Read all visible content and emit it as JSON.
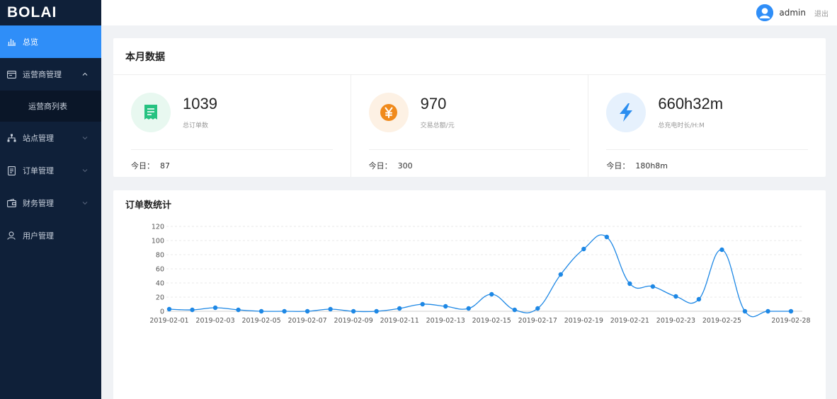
{
  "brand": "BOLAI",
  "sidebar": {
    "items": [
      {
        "label": "总览",
        "icon": "bar-chart-icon",
        "active": true
      },
      {
        "label": "运营商管理",
        "icon": "id-card-icon",
        "expanded": true,
        "children": [
          {
            "label": "运营商列表"
          }
        ]
      },
      {
        "label": "站点管理",
        "icon": "sitemap-icon"
      },
      {
        "label": "订单管理",
        "icon": "document-icon"
      },
      {
        "label": "财务管理",
        "icon": "wallet-icon"
      },
      {
        "label": "用户管理",
        "icon": "user-icon"
      }
    ]
  },
  "header": {
    "username": "admin",
    "logout": "退出"
  },
  "monthly": {
    "title": "本月数据",
    "stats": [
      {
        "value": "1039",
        "label": "总订单数",
        "today_label": "今日：",
        "today_value": "87",
        "icon": "receipt-icon",
        "color": "#26c281",
        "bg": "#e8f8f0"
      },
      {
        "value": "970",
        "label": "交易总额/元",
        "today_label": "今日：",
        "today_value": "300",
        "icon": "yen-icon",
        "color": "#f08a1c",
        "bg": "#fdf1e4"
      },
      {
        "value": "660h32m",
        "label": "总充电时长/H:M",
        "today_label": "今日：",
        "today_value": "180h8m",
        "icon": "lightning-icon",
        "color": "#2b8ef0",
        "bg": "#e6f1fd"
      }
    ]
  },
  "chart_title": "订单数统计",
  "chart_data": {
    "type": "line",
    "smooth": true,
    "color": "#1e88e5",
    "ylim": [
      0,
      120
    ],
    "yticks": [
      0,
      20,
      40,
      60,
      80,
      100,
      120
    ],
    "grid": "horizontal-dashed",
    "x": [
      "2019-02-01",
      "2019-02-02",
      "2019-02-03",
      "2019-02-04",
      "2019-02-05",
      "2019-02-06",
      "2019-02-07",
      "2019-02-08",
      "2019-02-09",
      "2019-02-10",
      "2019-02-11",
      "2019-02-12",
      "2019-02-13",
      "2019-02-14",
      "2019-02-15",
      "2019-02-16",
      "2019-02-17",
      "2019-02-18",
      "2019-02-19",
      "2019-02-20",
      "2019-02-21",
      "2019-02-22",
      "2019-02-23",
      "2019-02-24",
      "2019-02-25",
      "2019-02-26",
      "2019-02-27",
      "2019-02-28"
    ],
    "tick_labels": [
      {
        "i": 0,
        "text": "2019-02-01"
      },
      {
        "i": 2,
        "text": "2019-02-03"
      },
      {
        "i": 4,
        "text": "2019-02-05"
      },
      {
        "i": 6,
        "text": "2019-02-07"
      },
      {
        "i": 8,
        "text": "2019-02-09"
      },
      {
        "i": 10,
        "text": "2019-02-11"
      },
      {
        "i": 12,
        "text": "2019-02-13"
      },
      {
        "i": 14,
        "text": "2019-02-15"
      },
      {
        "i": 16,
        "text": "2019-02-17"
      },
      {
        "i": 18,
        "text": "2019-02-19"
      },
      {
        "i": 20,
        "text": "2019-02-21"
      },
      {
        "i": 22,
        "text": "2019-02-23"
      },
      {
        "i": 24,
        "text": "2019-02-25"
      },
      {
        "i": 27,
        "text": "2019-02-28"
      }
    ],
    "values": [
      3,
      2,
      5,
      2,
      0,
      0,
      0,
      3,
      0,
      0,
      4,
      10,
      7,
      4,
      24,
      2,
      4,
      52,
      88,
      105,
      39,
      35,
      21,
      17,
      87,
      0,
      0,
      0
    ]
  }
}
